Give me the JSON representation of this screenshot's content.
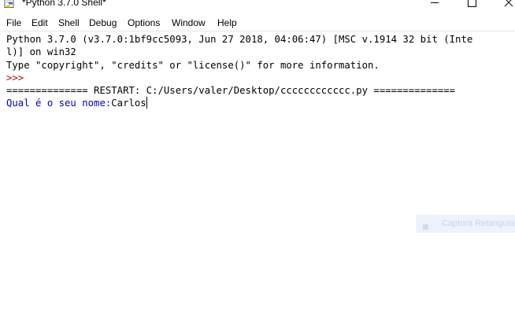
{
  "window": {
    "title": "*Python 3.7.0 Shell*"
  },
  "menu": {
    "items": [
      "File",
      "Edit",
      "Shell",
      "Debug",
      "Options",
      "Window",
      "Help"
    ]
  },
  "shell": {
    "lines": [
      "Python 3.7.0 (v3.7.0:1bf9cc5093, Jun 27 2018, 04:06:47) [MSC v.1914 32 bit (Inte",
      "l)] on win32",
      "Type \"copyright\", \"credits\" or \"license()\" for more information.",
      ">>> ",
      "============== RESTART: C:/Users/valer/Desktop/cccccccccccc.py =============="
    ],
    "prompt": "Qual é o seu nome:",
    "input": "Carlos"
  },
  "toast": {
    "label": "Captura Retangular"
  },
  "colors": {
    "prompt_red": "#c00000",
    "stdout_blue": "#0000c0",
    "text": "#000000",
    "background": "#ffffff"
  },
  "icons": {
    "title": "python-idle-icon",
    "minimize": "minimize-icon",
    "maximize": "maximize-icon",
    "close": "close-icon",
    "toast": "screenshot-tool-icon"
  }
}
